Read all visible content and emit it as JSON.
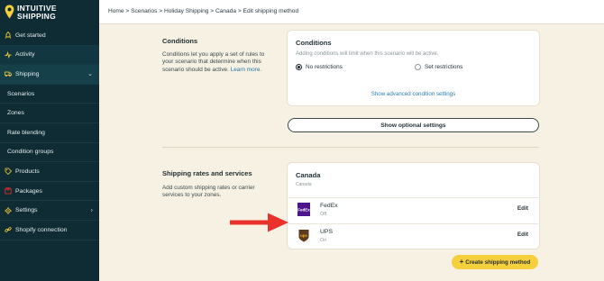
{
  "brand": {
    "line1": "INTUITIVE",
    "line2": "SHIPPING",
    "logo_icon": "location-pin-icon",
    "accent": "#f6cf3c"
  },
  "sidebar": {
    "items": [
      {
        "label": "Get started",
        "icon": "rocket-icon"
      },
      {
        "label": "Activity",
        "icon": "activity-icon"
      },
      {
        "label": "Shipping",
        "icon": "truck-icon"
      },
      {
        "label": "Scenarios"
      },
      {
        "label": "Zones"
      },
      {
        "label": "Rate blending"
      },
      {
        "label": "Condition groups"
      },
      {
        "label": "Products",
        "icon": "tag-icon"
      },
      {
        "label": "Packages",
        "icon": "package-icon"
      },
      {
        "label": "Settings",
        "icon": "gear-icon"
      },
      {
        "label": "Shopify connection",
        "icon": "link-icon"
      }
    ]
  },
  "breadcrumb": "Home > Scenarios > Holiday Shipping > Canada > Edit shipping method",
  "conditions": {
    "section_title": "Conditions",
    "section_desc": "Conditions let you apply a set of rules to your scenario that determine when this scenario should be active.",
    "learn_more": "Learn more.",
    "card_title": "Conditions",
    "card_hint": "Adding conditions will limit when this scenario will be active.",
    "option_no": "No restrictions",
    "option_set": "Set restrictions",
    "advanced_link": "Show advanced condition settings"
  },
  "optional_button": "Show optional settings",
  "rates": {
    "section_title": "Shipping rates and services",
    "section_desc": "Add custom shipping rates or carrier services to your zones.",
    "card_title": "Canada",
    "card_sub": "Canada",
    "carriers": [
      {
        "name": "FedEx",
        "status": "Off",
        "edit": "Edit",
        "logo": "fedex-logo"
      },
      {
        "name": "UPS",
        "status": "On",
        "edit": "Edit",
        "logo": "ups-logo"
      }
    ]
  },
  "create_button": "Create shipping method",
  "colors": {
    "sidebar": "#0f2b33",
    "background": "#f7f1e3",
    "link": "#2a7fae",
    "arrow": "#e8322b"
  }
}
